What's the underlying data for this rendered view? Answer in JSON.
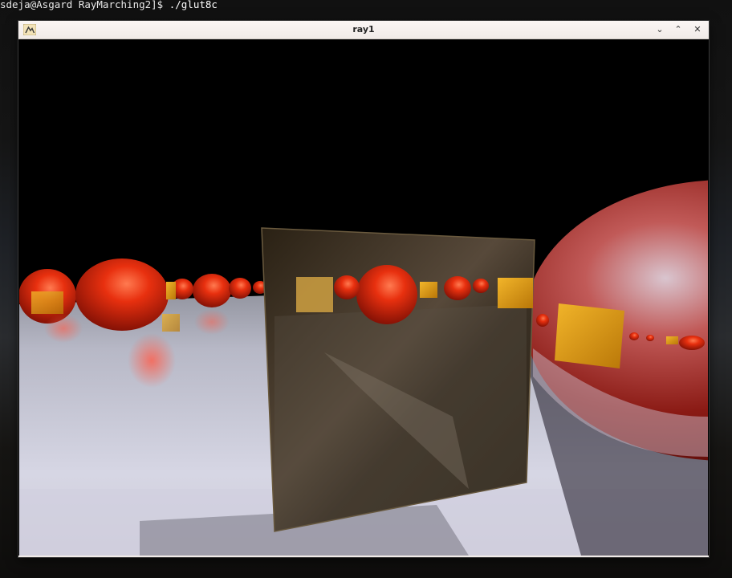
{
  "terminal": {
    "prompt": "sdeja@Asgard RayMarching2]$",
    "command": "./glut8c"
  },
  "window": {
    "title": "ray1",
    "minimize_glyph": "⌄",
    "maximize_glyph": "⌃",
    "close_glyph": "✕"
  },
  "scene": {
    "sphere_color": "#d92a0c",
    "cube_color": "#e2a21a",
    "mirror_cube_color": "#3d3020",
    "floor_color": "#c7c9dc",
    "sky_color": "#000000"
  }
}
